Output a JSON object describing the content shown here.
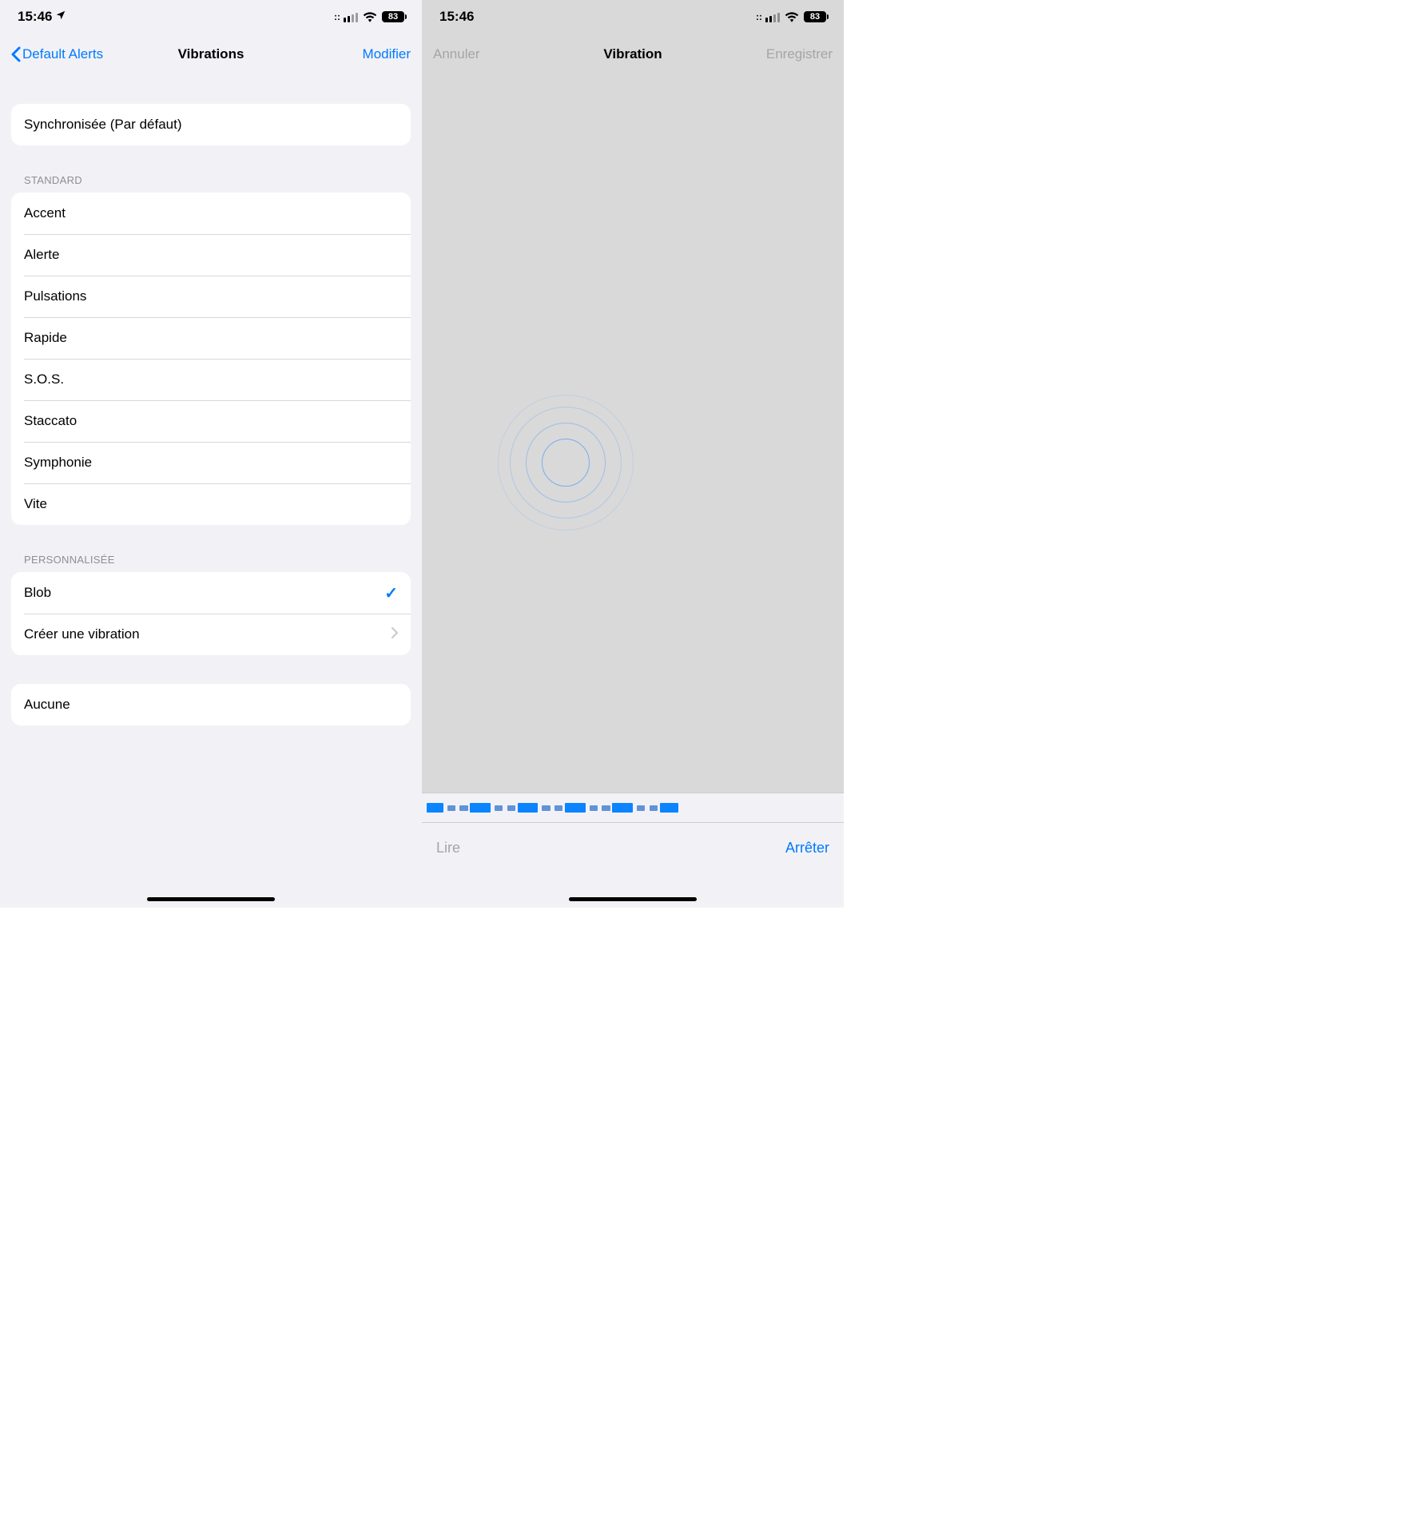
{
  "status": {
    "time": "15:46",
    "battery": "83",
    "location_visible": true
  },
  "left": {
    "back_label": "Default Alerts",
    "title": "Vibrations",
    "action": "Modifier",
    "default_group": {
      "item": "Synchronisée (Par défaut)"
    },
    "standard_label": "STANDARD",
    "standard_items": [
      "Accent",
      "Alerte",
      "Pulsations",
      "Rapide",
      "S.O.S.",
      "Staccato",
      "Symphonie",
      "Vite"
    ],
    "custom_label": "PERSONNALISÉE",
    "custom_selected": "Blob",
    "custom_create": "Créer une vibration",
    "none_item": "Aucune"
  },
  "right": {
    "cancel": "Annuler",
    "title": "Vibration",
    "save": "Enregistrer",
    "play": "Lire",
    "stop": "Arrêter",
    "pattern_segments": [
      {
        "start": 0,
        "width": 4.0,
        "dim": false
      },
      {
        "start": 5.0,
        "width": 2.0,
        "dim": true
      },
      {
        "start": 8.0,
        "width": 2.0,
        "dim": true
      },
      {
        "start": 10.5,
        "width": 5.0,
        "dim": false
      },
      {
        "start": 16.5,
        "width": 2.0,
        "dim": true
      },
      {
        "start": 19.5,
        "width": 2.0,
        "dim": true
      },
      {
        "start": 22.0,
        "width": 5.0,
        "dim": false
      },
      {
        "start": 28.0,
        "width": 2.0,
        "dim": true
      },
      {
        "start": 31.0,
        "width": 2.0,
        "dim": true
      },
      {
        "start": 33.5,
        "width": 5.0,
        "dim": false
      },
      {
        "start": 39.5,
        "width": 2.0,
        "dim": true
      },
      {
        "start": 42.5,
        "width": 2.0,
        "dim": true
      },
      {
        "start": 45.0,
        "width": 5.0,
        "dim": false
      },
      {
        "start": 51.0,
        "width": 2.0,
        "dim": true
      },
      {
        "start": 54.0,
        "width": 2.0,
        "dim": true
      },
      {
        "start": 56.5,
        "width": 4.5,
        "dim": false
      }
    ]
  }
}
